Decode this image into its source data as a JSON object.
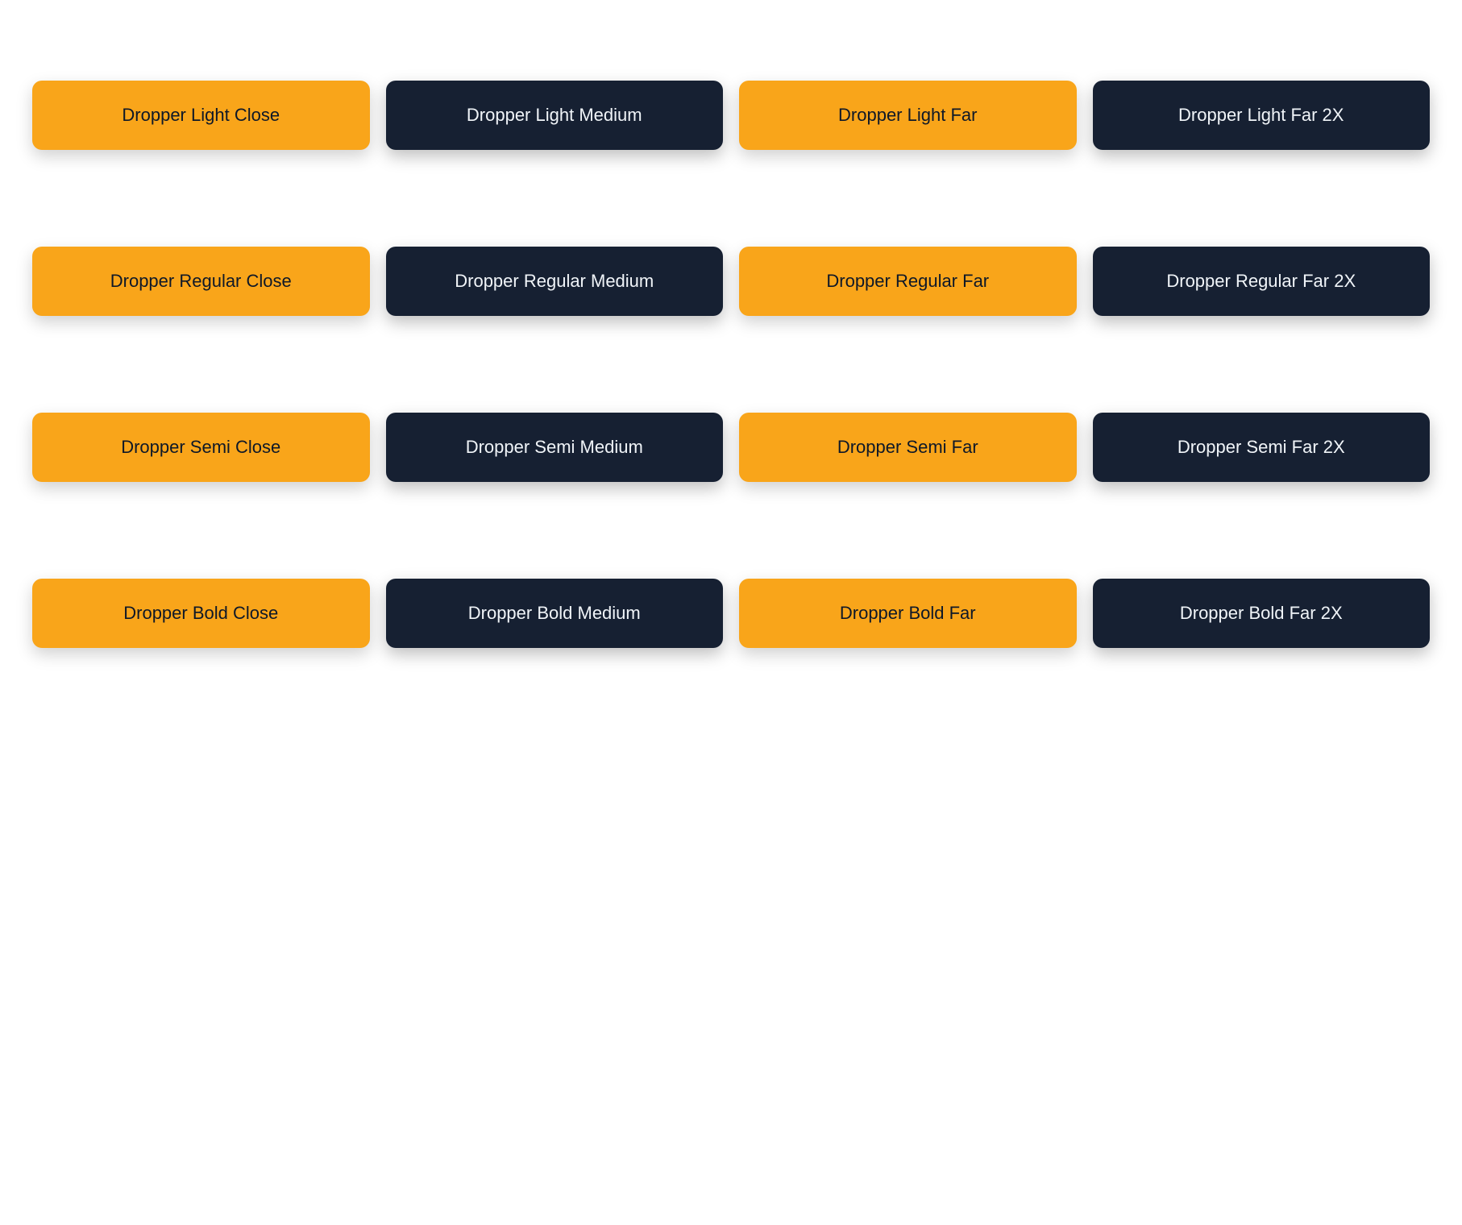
{
  "rows": [
    {
      "id": "light-row",
      "buttons": [
        {
          "id": "dropper-light-close",
          "label": "Dropper Light Close",
          "variant": "orange"
        },
        {
          "id": "dropper-light-medium",
          "label": "Dropper Light Medium",
          "variant": "dark"
        },
        {
          "id": "dropper-light-far",
          "label": "Dropper Light Far",
          "variant": "orange"
        },
        {
          "id": "dropper-light-far-2x",
          "label": "Dropper Light Far 2X",
          "variant": "dark"
        }
      ]
    },
    {
      "id": "regular-row",
      "buttons": [
        {
          "id": "dropper-regular-close",
          "label": "Dropper Regular Close",
          "variant": "orange"
        },
        {
          "id": "dropper-regular-medium",
          "label": "Dropper Regular Medium",
          "variant": "dark"
        },
        {
          "id": "dropper-regular-far",
          "label": "Dropper Regular Far",
          "variant": "orange"
        },
        {
          "id": "dropper-regular-far-2x",
          "label": "Dropper Regular Far 2X",
          "variant": "dark"
        }
      ]
    },
    {
      "id": "semi-row",
      "buttons": [
        {
          "id": "dropper-semi-close",
          "label": "Dropper Semi Close",
          "variant": "orange"
        },
        {
          "id": "dropper-semi-medium",
          "label": "Dropper Semi Medium",
          "variant": "dark"
        },
        {
          "id": "dropper-semi-far",
          "label": "Dropper Semi Far",
          "variant": "orange"
        },
        {
          "id": "dropper-semi-far-2x",
          "label": "Dropper Semi Far 2X",
          "variant": "dark"
        }
      ]
    },
    {
      "id": "bold-row",
      "buttons": [
        {
          "id": "dropper-bold-close",
          "label": "Dropper Bold Close",
          "variant": "orange"
        },
        {
          "id": "dropper-bold-medium",
          "label": "Dropper Bold Medium",
          "variant": "dark"
        },
        {
          "id": "dropper-bold-far",
          "label": "Dropper Bold Far",
          "variant": "orange"
        },
        {
          "id": "dropper-bold-far-2x",
          "label": "Dropper Bold Far 2X",
          "variant": "dark"
        }
      ]
    }
  ]
}
